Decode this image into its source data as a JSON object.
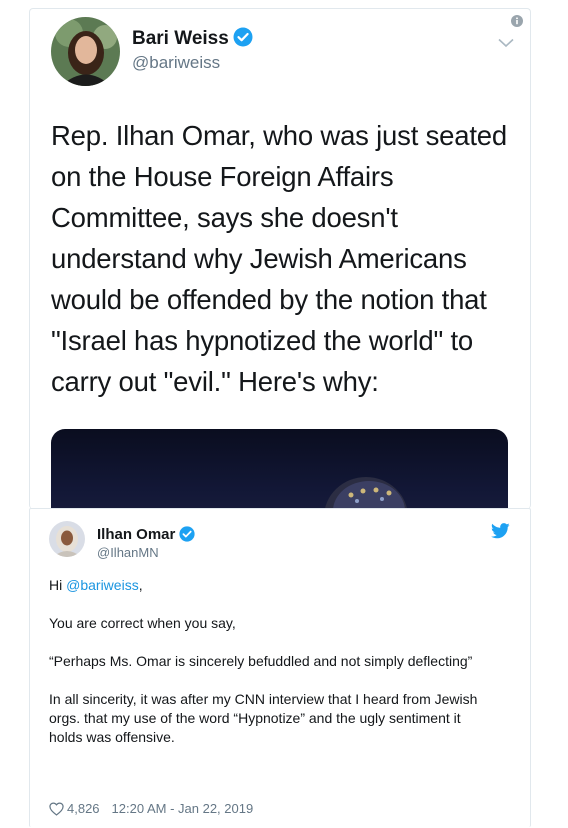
{
  "tweet": {
    "name": "Bari Weiss",
    "handle": "@bariweiss",
    "text": "Rep. Ilhan Omar, who was just seated on the House Foreign Affairs Committee, says she doesn't understand why Jewish Americans would be offended by the notion that \"Israel has hypnotized the world\" to carry out \"evil.\" Here's why:"
  },
  "quoted": {
    "name": "Ilhan Omar",
    "handle": "@IlhanMN",
    "greeting_prefix": "Hi ",
    "greeting_mention": "@bariweiss",
    "greeting_suffix": ",",
    "para1": "You are correct when you say,",
    "para2": "“Perhaps Ms. Omar is sincerely befuddled and not simply deflecting”",
    "para3": "In all sincerity, it was after my CNN interview that I heard from Jewish orgs. that my use of the word “Hypnotize” and the ugly sentiment it holds was offensive.",
    "likes": "4,826",
    "timestamp": "12:20 AM - Jan 22, 2019"
  },
  "colors": {
    "link": "#1b95e0",
    "muted": "#657786",
    "verified": "#1da1f2"
  },
  "icons": [
    "verified-badge-icon",
    "info-icon",
    "chevron-down-icon",
    "twitter-bird-icon",
    "heart-icon"
  ]
}
